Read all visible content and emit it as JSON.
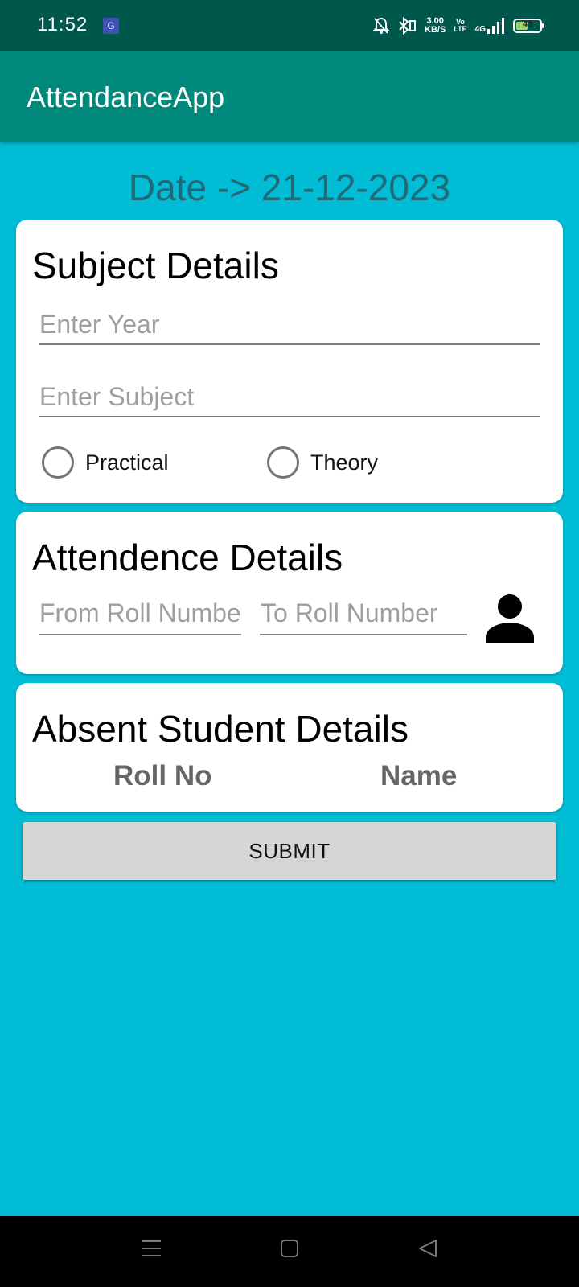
{
  "status_bar": {
    "time": "11:52",
    "app_icon_letter": "G",
    "speed_value": "3.00",
    "speed_unit": "KB/S",
    "volte_top": "Vo",
    "volte_bottom": "LTE",
    "network_type": "4G",
    "battery_level": "43"
  },
  "app_bar": {
    "title": "AttendanceApp"
  },
  "date_label": "Date -> 21-12-2023",
  "subject_card": {
    "title": "Subject Details",
    "year_input": {
      "placeholder": "Enter Year",
      "value": ""
    },
    "subject_input": {
      "placeholder": "Enter Subject",
      "value": ""
    },
    "radio_practical": "Practical",
    "radio_theory": "Theory"
  },
  "attendance_card": {
    "title": "Attendence Details",
    "from_roll_input": {
      "placeholder": "From Roll Number",
      "value": ""
    },
    "to_roll_input": {
      "placeholder": "To Roll Number",
      "value": ""
    },
    "icon": "person-icon"
  },
  "absent_card": {
    "title": "Absent Student Details",
    "columns": [
      "Roll No",
      "Name"
    ]
  },
  "submit_label": "SUBMIT",
  "navbar": {
    "icons": [
      "menu-icon",
      "home-icon",
      "back-icon"
    ]
  },
  "colors": {
    "status_bar": "#00574B",
    "app_bar": "#00897B",
    "background": "#00BCD4",
    "date_text": "#216978",
    "submit_bg": "#D6D6D6"
  }
}
